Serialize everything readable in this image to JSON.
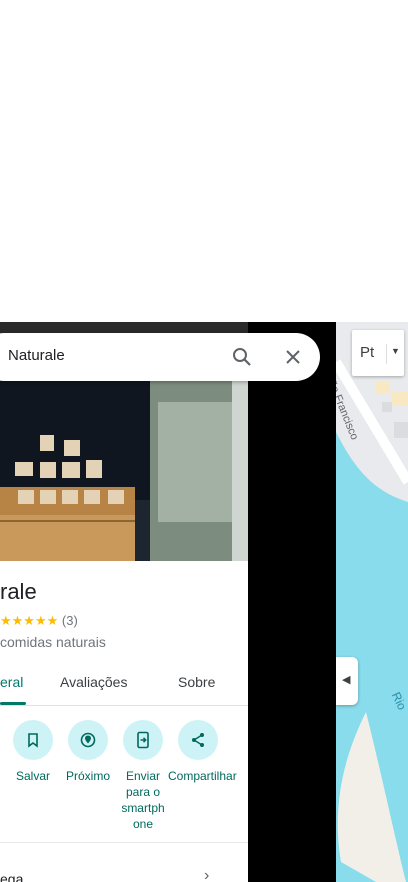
{
  "search": {
    "query": "Naturale"
  },
  "place": {
    "title": "rale",
    "stars": "★★★★★",
    "review_count": "(3)",
    "category": "comidas naturais"
  },
  "tabs": [
    {
      "label": "eral",
      "active": true
    },
    {
      "label": "Avaliações",
      "active": false
    },
    {
      "label": "Sobre",
      "active": false
    }
  ],
  "actions": [
    {
      "label": "Salvar",
      "icon": "bookmark-icon"
    },
    {
      "label": "Próximo",
      "icon": "nearby-icon"
    },
    {
      "label": "Enviar para o smartph one",
      "icon": "send-to-phone-icon"
    },
    {
      "label": "Compartilhar",
      "icon": "share-icon"
    }
  ],
  "bottom": {
    "text": "ega"
  },
  "map": {
    "street_label": "São Francisco",
    "water_label": "Rio",
    "layer_label": "Pt"
  },
  "colors": {
    "accent": "#00796b",
    "action_bg": "#cdf3f7",
    "water": "#89dcec",
    "land": "#e9eaed"
  }
}
